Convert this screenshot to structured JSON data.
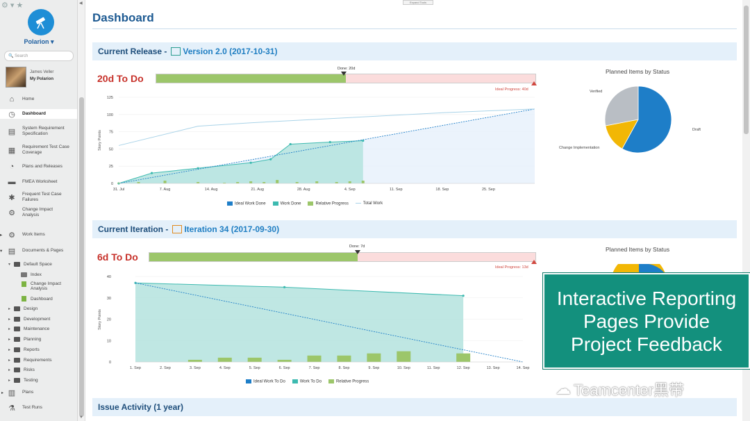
{
  "app": {
    "name": "Polarion",
    "search_placeholder": "Search"
  },
  "user": {
    "name": "James Veller",
    "project_link": "My Polarion"
  },
  "toolbar": {
    "expand_tools": "Expand Tools"
  },
  "nav": [
    {
      "label": "Home",
      "icon": "home-icon"
    },
    {
      "label": "Dashboard",
      "icon": "dashboard-icon",
      "active": true
    },
    {
      "label": "System Requirement Specification",
      "icon": "document-icon"
    },
    {
      "label": "Requirement Test Case Coverage",
      "icon": "table-icon"
    },
    {
      "label": "Plans and Releases",
      "icon": "clock-icon"
    },
    {
      "label": "FMEA Worksheet",
      "icon": "folder-icon"
    },
    {
      "label": "Frequent Test Case Failures",
      "icon": "bug-icon"
    },
    {
      "label": "Change Impact Analysis",
      "icon": "gear-icon"
    },
    {
      "label": "Work Items",
      "icon": "gears-icon"
    },
    {
      "label": "Documents & Pages",
      "icon": "documents-icon"
    }
  ],
  "tree": {
    "default_space": "Default Space",
    "default_space_children": [
      "Index",
      "Change Impact Analysis",
      "Dashboard"
    ],
    "spaces": [
      "Design",
      "Development",
      "Maintenance",
      "Planning",
      "Reports",
      "Requirements",
      "Risks",
      "Testing"
    ],
    "plans": "Plans",
    "test_runs": "Test Runs"
  },
  "page": {
    "title": "Dashboard"
  },
  "release": {
    "header_prefix": "Current Release - ",
    "header_link": "Version 2.0 (2017-10-31)",
    "todo": "20d To Do",
    "done_label": "Done: 20d",
    "ideal_label": "Ideal Progress: 40d",
    "progress_done_fraction": 0.5
  },
  "iteration": {
    "header_prefix": "Current Iteration - ",
    "header_link": "Iteration 34 (2017-09-30)",
    "todo": "6d To Do",
    "done_label": "Done: 7d",
    "ideal_label": "Ideal Progress: 13d",
    "progress_done_fraction": 0.54
  },
  "issue_activity": {
    "header": "Issue Activity (1 year)"
  },
  "overlay": {
    "lines": [
      "Interactive Reporting",
      "Pages Provide",
      "Project Feedback"
    ]
  },
  "watermark": {
    "text": "Teamcenter黑带"
  },
  "colors": {
    "ideal": "#1e7ec8",
    "done": "#3dbab0",
    "relative": "#9cc66a",
    "total": "#a9d3e8",
    "header_bg": "#e4f0fa"
  },
  "chart_data": [
    {
      "type": "line",
      "ylabel": "Story Points",
      "ylim": [
        0,
        125
      ],
      "yticks": [
        0,
        25,
        50,
        75,
        100,
        125
      ],
      "xticks": [
        "31. Jul",
        "7. Aug",
        "14. Aug",
        "21. Aug",
        "28. Aug",
        "4. Sep",
        "11. Sep",
        "18. Sep",
        "25. Sep"
      ],
      "series": [
        {
          "name": "Ideal Work Done",
          "x": [
            0,
            63
          ],
          "y": [
            0,
            108
          ]
        },
        {
          "name": "Work Done",
          "x": [
            0,
            5,
            12,
            20,
            23,
            26,
            32,
            37
          ],
          "y": [
            0,
            15,
            22,
            30,
            35,
            57,
            60,
            62
          ]
        },
        {
          "name": "Total Work",
          "x": [
            0,
            12,
            20,
            30,
            40,
            50,
            63
          ],
          "y": [
            55,
            83,
            88,
            93,
            98,
            103,
            108
          ]
        },
        {
          "name": "Relative Progress",
          "x": [
            0,
            3,
            7,
            12,
            16,
            18,
            20,
            22,
            24,
            27,
            30,
            33,
            35,
            37
          ],
          "y": [
            1,
            2,
            4,
            2,
            1,
            2,
            3,
            2,
            5,
            2,
            3,
            2,
            3,
            4
          ]
        }
      ],
      "legend": [
        "Ideal Work Done",
        "Work Done",
        "Relative Progress",
        "Total Work"
      ]
    },
    {
      "type": "pie",
      "title": "Planned Items by Status",
      "slices": [
        {
          "label": "Draft",
          "value": 58,
          "color": "#1e7ec8"
        },
        {
          "label": "Change Implementation",
          "value": 14,
          "color": "#f2b705"
        },
        {
          "label": "Verified",
          "value": 28,
          "color": "#b9bec4"
        }
      ]
    },
    {
      "type": "line",
      "ylabel": "Story Points",
      "ylim": [
        0,
        40
      ],
      "yticks": [
        0,
        10,
        20,
        30,
        40
      ],
      "xticks": [
        "1. Sep",
        "2. Sep",
        "3. Sep",
        "4. Sep",
        "5. Sep",
        "6. Sep",
        "7. Sep",
        "8. Sep",
        "9. Sep",
        "10. Sep",
        "11. Sep",
        "12. Sep",
        "13. Sep",
        "14. Sep"
      ],
      "series": [
        {
          "name": "Ideal Work To Do",
          "x": [
            0,
            13
          ],
          "y": [
            37,
            0
          ]
        },
        {
          "name": "Work To Do",
          "x": [
            0,
            5,
            11
          ],
          "y": [
            37,
            35,
            31
          ]
        },
        {
          "name": "Relative Progress",
          "x": [
            2,
            3,
            4,
            5,
            6,
            7,
            8,
            9,
            11
          ],
          "y": [
            1,
            2,
            2,
            1,
            3,
            3,
            4,
            5,
            4
          ]
        }
      ],
      "legend": [
        "Ideal Work To Do",
        "Work To Do",
        "Relative Progress"
      ]
    },
    {
      "type": "pie",
      "title": "Planned Items by Status"
    }
  ]
}
